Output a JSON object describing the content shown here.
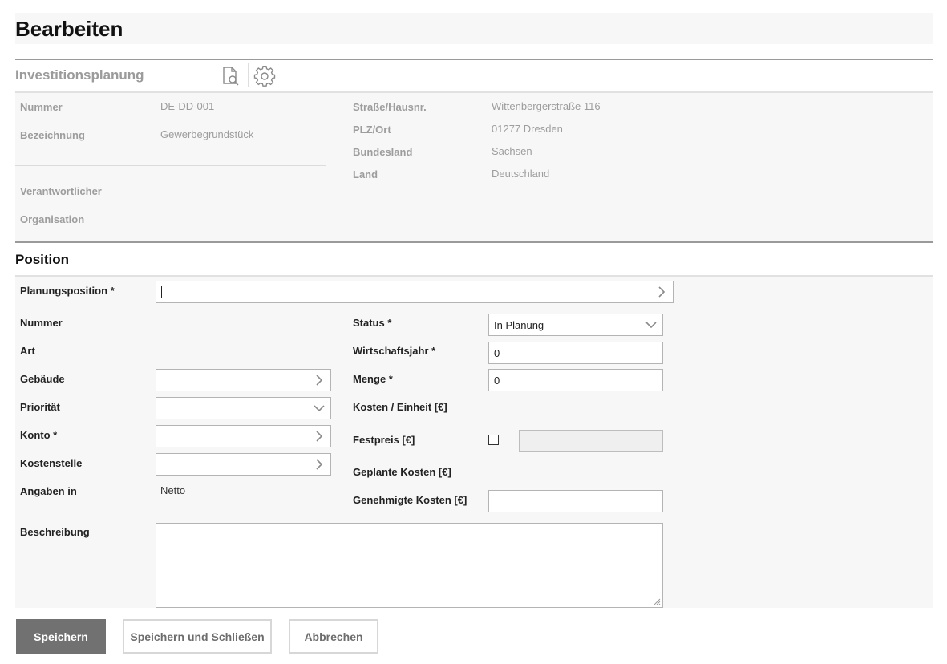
{
  "header": {
    "title": "Bearbeiten"
  },
  "summary": {
    "title": "Investitionsplanung",
    "icons": {
      "preview": "document-search-icon",
      "settings": "gear-icon"
    },
    "left": [
      {
        "label": "Nummer",
        "value": "DE-DD-001"
      },
      {
        "label": "Bezeichnung",
        "value": "Gewerbegrundstück"
      },
      {
        "label": "Verantwortlicher",
        "value": ""
      },
      {
        "label": "Organisation",
        "value": ""
      }
    ],
    "right": [
      {
        "label": "Straße/Hausnr.",
        "value": "Wittenbergerstraße 116"
      },
      {
        "label": "PLZ/Ort",
        "value": "01277 Dresden"
      },
      {
        "label": "Bundesland",
        "value": "Sachsen"
      },
      {
        "label": "Land",
        "value": "Deutschland"
      }
    ]
  },
  "position": {
    "title": "Position",
    "planungsposition": {
      "label": "Planungsposition *",
      "value": ""
    },
    "nummer": {
      "label": "Nummer",
      "value": ""
    },
    "art": {
      "label": "Art",
      "value": ""
    },
    "gebaeude": {
      "label": "Gebäude",
      "value": ""
    },
    "prioritaet": {
      "label": "Priorität",
      "value": ""
    },
    "konto": {
      "label": "Konto *",
      "value": ""
    },
    "kostenstelle": {
      "label": "Kostenstelle",
      "value": ""
    },
    "angaben_in": {
      "label": "Angaben in",
      "value": "Netto"
    },
    "beschreibung": {
      "label": "Beschreibung",
      "value": ""
    },
    "status": {
      "label": "Status *",
      "value": "In Planung"
    },
    "wirtschaftsjahr": {
      "label": "Wirtschaftsjahr *",
      "value": "0"
    },
    "menge": {
      "label": "Menge *",
      "value": "0"
    },
    "kosten_einheit": {
      "label": "Kosten / Einheit [€]",
      "value": ""
    },
    "festpreis": {
      "label": "Festpreis [€]",
      "checked": false,
      "value": ""
    },
    "geplante_kosten": {
      "label": "Geplante Kosten [€]",
      "value": ""
    },
    "genehmigte_kosten": {
      "label": "Genehmigte Kosten [€]",
      "value": ""
    }
  },
  "actions": {
    "save": "Speichern",
    "save_close": "Speichern und Schließen",
    "cancel": "Abbrechen"
  },
  "colors": {
    "primary_button": "#717171",
    "panel_bg": "#f7f7f7",
    "muted_text": "#9d9d9d"
  }
}
